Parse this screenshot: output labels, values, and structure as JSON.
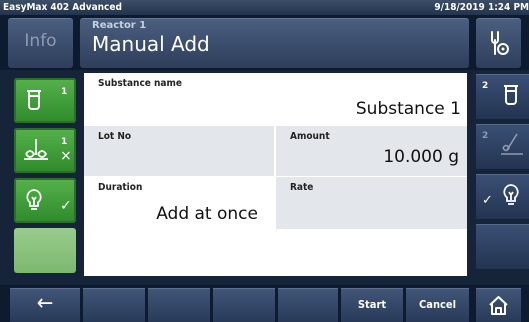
{
  "statusbar": {
    "device_name": "EasyMax 402 Advanced",
    "datetime": "9/18/2019 1:24 PM"
  },
  "header": {
    "info_label": "Info",
    "reactor_label": "Reactor 1",
    "title": "Manual Add",
    "settings_icon": "wrench-gear-icon"
  },
  "left_buttons": [
    {
      "icon": "beaker-icon",
      "number": "1",
      "state": "",
      "active": true
    },
    {
      "icon": "stirrer-icon",
      "number": "1",
      "state": "×",
      "active": true
    },
    {
      "icon": "bulb-icon",
      "number": "",
      "state": "✓",
      "active": true
    },
    {
      "icon": "",
      "number": "",
      "state": "",
      "active": false
    }
  ],
  "fields": {
    "substance": {
      "label": "Substance name",
      "value": "Substance 1"
    },
    "lot": {
      "label": "Lot No",
      "value": ""
    },
    "amount": {
      "label": "Amount",
      "value": "10.000 g"
    },
    "duration": {
      "label": "Duration",
      "value": "Add at once"
    },
    "rate": {
      "label": "Rate",
      "value": ""
    }
  },
  "right_buttons": [
    {
      "icon": "beaker-icon",
      "number": "2",
      "state": ""
    },
    {
      "icon": "stirrer-icon",
      "number": "2",
      "state": ""
    },
    {
      "icon": "bulb-icon",
      "number": "",
      "state": "✓"
    },
    {
      "icon": "",
      "number": "",
      "state": ""
    }
  ],
  "footer": {
    "back_label": "←",
    "start_label": "Start",
    "cancel_label": "Cancel",
    "home_icon": "home-icon"
  },
  "colors": {
    "background": "#16243a",
    "active_green": "#3f9e39",
    "inactive_green": "#8dc581",
    "button_blue": "#34476a",
    "field_grey": "#e3e6ea"
  }
}
